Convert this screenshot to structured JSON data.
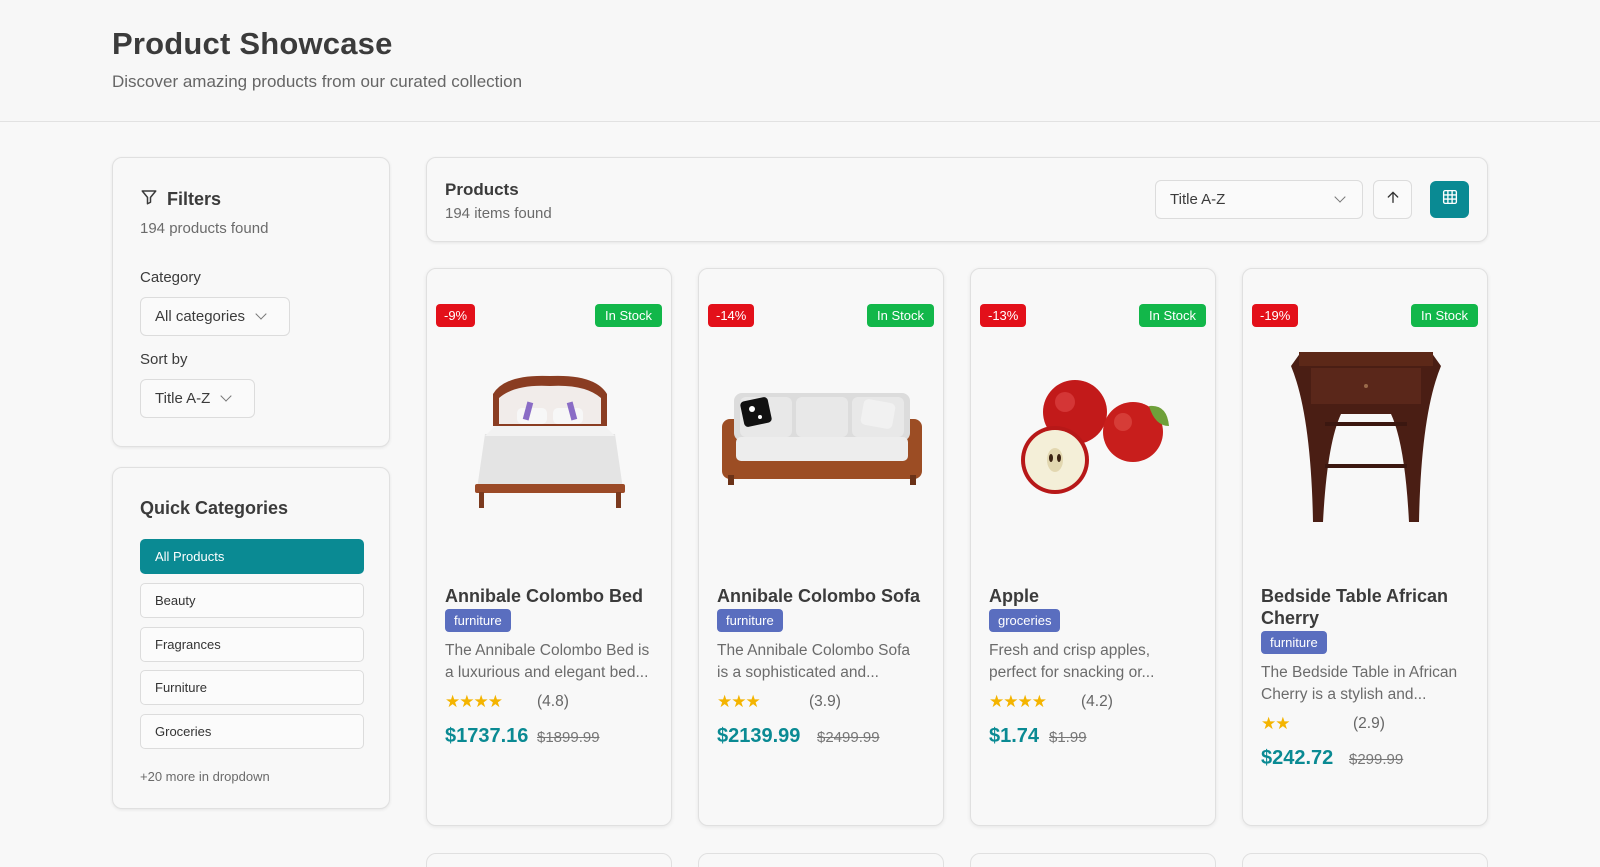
{
  "header": {
    "title": "Product Showcase",
    "subtitle": "Discover amazing products from our curated collection"
  },
  "filters": {
    "title": "Filters",
    "count": "194 products found",
    "category_label": "Category",
    "category_value": "All categories",
    "sort_label": "Sort by",
    "sort_value": "Title A-Z"
  },
  "quick_categories": {
    "title": "Quick Categories",
    "items": [
      {
        "label": "All Products",
        "active": true
      },
      {
        "label": "Beauty",
        "active": false
      },
      {
        "label": "Fragrances",
        "active": false
      },
      {
        "label": "Furniture",
        "active": false
      },
      {
        "label": "Groceries",
        "active": false
      }
    ],
    "more": "+20 more in dropdown"
  },
  "products_bar": {
    "title": "Products",
    "count": "194 items found",
    "sort_value": "Title A-Z",
    "sort_direction_icon": "arrow-up-icon",
    "view_icon": "grid-icon"
  },
  "colors": {
    "accent": "#0a8a93",
    "discount": "#e3101a",
    "in_stock": "#12b74a",
    "category_badge": "#5a6ebf",
    "star": "#f4b400"
  },
  "products": [
    {
      "discount": "-9%",
      "stock": "In Stock",
      "name": "Annibale Colombo Bed",
      "category": "furniture",
      "desc1": "The Annibale Colombo Bed is",
      "desc2": "a luxurious and elegant bed...",
      "stars": "★★★★",
      "rating": "(4.8)",
      "price": "$1737.16",
      "old_price": "$1899.99",
      "image": "bed"
    },
    {
      "discount": "-14%",
      "stock": "In Stock",
      "name": "Annibale Colombo Sofa",
      "category": "furniture",
      "desc1": "The Annibale Colombo Sofa",
      "desc2": "is a sophisticated and...",
      "stars": "★★★",
      "rating": "(3.9)",
      "price": "$2139.99",
      "old_price": "$2499.99",
      "image": "sofa"
    },
    {
      "discount": "-13%",
      "stock": "In Stock",
      "name": "Apple",
      "category": "groceries",
      "desc1": "Fresh and crisp apples,",
      "desc2": "perfect for snacking or...",
      "stars": "★★★★",
      "rating": "(4.2)",
      "price": "$1.74",
      "old_price": "$1.99",
      "image": "apple"
    },
    {
      "discount": "-19%",
      "stock": "In Stock",
      "name": "Bedside Table African Cherry",
      "category": "furniture",
      "desc1": "The Bedside Table in African",
      "desc2": "Cherry is a stylish and...",
      "stars": "★★",
      "rating": "(2.9)",
      "price": "$242.72",
      "old_price": "$299.99",
      "image": "bedside-table"
    }
  ]
}
